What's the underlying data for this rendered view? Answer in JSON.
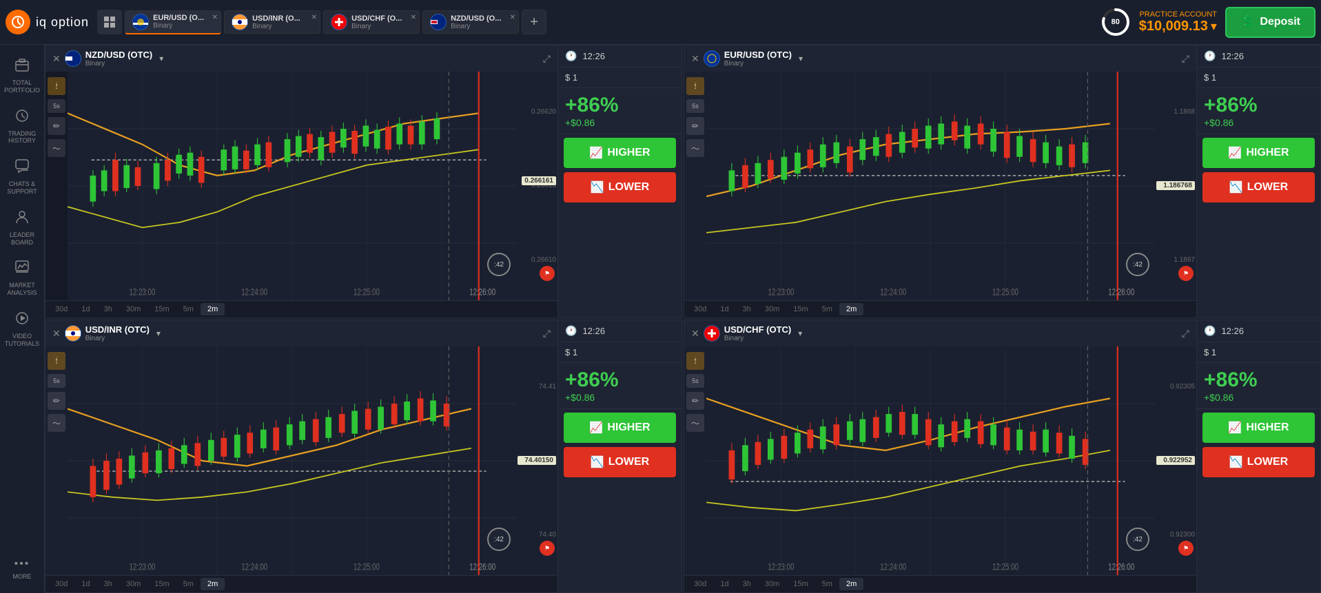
{
  "app": {
    "logo": "IQ",
    "name": "iq option"
  },
  "account": {
    "type": "PRACTICE ACCOUNT",
    "balance": "$10,009.13",
    "progress": 80,
    "deposit_label": "Deposit"
  },
  "tabs": [
    {
      "id": "eurusd",
      "name": "EUR/USD (O...",
      "type": "Binary",
      "active": true
    },
    {
      "id": "usdinr",
      "name": "USD/INR (O...",
      "type": "Binary",
      "active": false
    },
    {
      "id": "usdchf",
      "name": "USD/CHF (O...",
      "type": "Binary",
      "active": false
    },
    {
      "id": "nzdusd",
      "name": "NZD/USD (O...",
      "type": "Binary",
      "active": false
    }
  ],
  "sidebar": {
    "items": [
      {
        "id": "portfolio",
        "label": "TOTAL\nPORTFOLIO",
        "icon": "🗂"
      },
      {
        "id": "history",
        "label": "TRADING\nHISTORY",
        "icon": "🕐"
      },
      {
        "id": "chats",
        "label": "CHATS &\nSUPPORT",
        "icon": "💬"
      },
      {
        "id": "leaderboard",
        "label": "LEADER\nBOARD",
        "icon": "👤"
      },
      {
        "id": "analysis",
        "label": "MARKET\nANALYSIS",
        "icon": "📊"
      },
      {
        "id": "tutorials",
        "label": "VIDEO\nTUTORIALS",
        "icon": "▶"
      },
      {
        "id": "more",
        "label": "MORE",
        "icon": "•••"
      }
    ]
  },
  "charts": [
    {
      "id": "nzdusd",
      "title": "NZD/USD (OTC)",
      "subtitle": "Binary",
      "time": "12:26",
      "amount": "$ 1",
      "payout_pct": "+86%",
      "payout_val": "+$0.86",
      "current_price": "0.26616",
      "price_tag": "0.266161",
      "prices": [
        "0.26620",
        "0.26615",
        "0.26610"
      ],
      "dashed_price": "0.26615",
      "timer": ":42",
      "timeframes": [
        "30d",
        "1d",
        "3h",
        "30m",
        "15m",
        "5m",
        "2m"
      ],
      "active_tf": "2m"
    },
    {
      "id": "eurusd",
      "title": "EUR/USD (OTC)",
      "subtitle": "Binary",
      "time": "12:26",
      "amount": "$ 1",
      "payout_pct": "+86%",
      "payout_val": "+$0.86",
      "current_price": "1.186768",
      "price_tag": "1.186768",
      "prices": [
        "1.1868",
        "1.1867"
      ],
      "dashed_price": "1.1867",
      "timer": ":42",
      "timeframes": [
        "30d",
        "1d",
        "3h",
        "30m",
        "15m",
        "5m",
        "2m"
      ],
      "active_tf": "2m"
    },
    {
      "id": "usdinr",
      "title": "USD/INR (OTC)",
      "subtitle": "Binary",
      "time": "12:26",
      "amount": "$ 1",
      "payout_pct": "+86%",
      "payout_val": "+$0.86",
      "current_price": "74.40150",
      "price_tag": "74.40150",
      "prices": [
        "74.41",
        "74.40"
      ],
      "dashed_price": "74.40",
      "timer": ":42",
      "timeframes": [
        "30d",
        "1d",
        "3h",
        "30m",
        "15m",
        "5m",
        "2m"
      ],
      "active_tf": "2m"
    },
    {
      "id": "usdchf",
      "title": "USD/CHF (OTC)",
      "subtitle": "Binary",
      "time": "12:26",
      "amount": "$ 1",
      "payout_pct": "+86%",
      "payout_val": "+$0.86",
      "current_price": "0.922952",
      "price_tag": "0.922952",
      "prices": [
        "0.92305",
        "0.92300"
      ],
      "dashed_price": "0.92295",
      "timer": ":42",
      "timeframes": [
        "30d",
        "1d",
        "3h",
        "30m",
        "15m",
        "5m",
        "2m"
      ],
      "active_tf": "2m"
    }
  ],
  "buttons": {
    "higher": "HIGHER",
    "lower": "LOWER"
  }
}
